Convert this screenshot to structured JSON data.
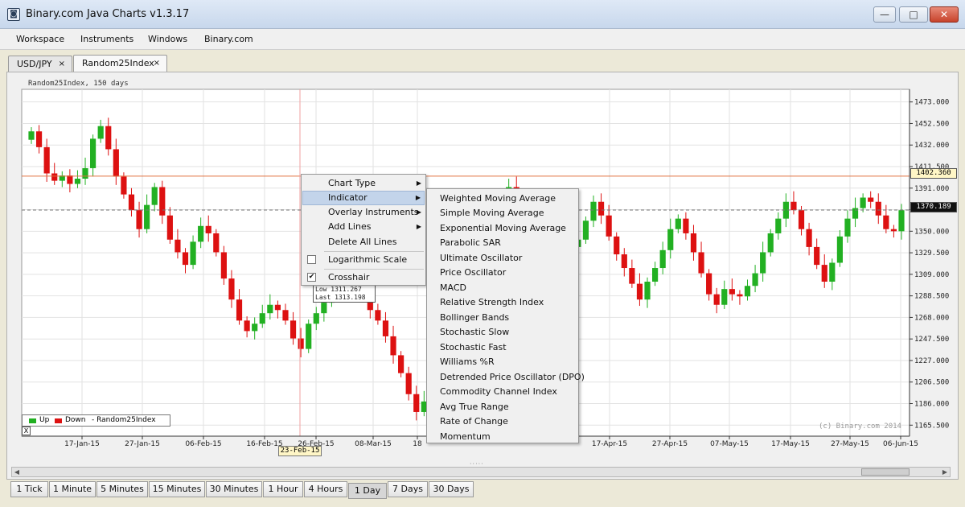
{
  "window": {
    "title": "Binary.com Java Charts v1.3.17",
    "minimize": "—",
    "maximize": "□",
    "close": "✕"
  },
  "menu": {
    "items": [
      "Workspace",
      "Instruments",
      "Windows",
      "Binary.com"
    ]
  },
  "tabs": [
    {
      "label": "USD/JPY",
      "close": "×"
    },
    {
      "label": "Random25Index",
      "close": "×"
    }
  ],
  "chart_header": "Random25Index, 150 days",
  "chart_data": {
    "type": "candlestick",
    "symbol": "Random25Index",
    "y_ticks": [
      "1473.000",
      "1452.500",
      "1432.000",
      "1411.500",
      "1391.000",
      "1370.500",
      "1350.000",
      "1329.500",
      "1309.000",
      "1288.500",
      "1268.000",
      "1247.500",
      "1227.000",
      "1206.500",
      "1186.000",
      "1165.500"
    ],
    "x_ticks": [
      "17-Jan-15",
      "27-Jan-15",
      "06-Feb-15",
      "16-Feb-15",
      "26-Feb-15",
      "08-Mar-15",
      "18",
      "17-Apr-15",
      "27-Apr-15",
      "07-May-15",
      "17-May-15",
      "27-May-15",
      "06-Jun-15"
    ],
    "ylim": [
      1155,
      1485
    ],
    "crosshair_price": "1402.360",
    "last_price": "1370.189",
    "crosshair_date": "23-Feb-15",
    "closes": [
      1445,
      1430,
      1405,
      1398,
      1403,
      1395,
      1400,
      1410,
      1438,
      1450,
      1428,
      1402,
      1385,
      1370,
      1352,
      1375,
      1392,
      1365,
      1342,
      1330,
      1318,
      1340,
      1355,
      1348,
      1330,
      1305,
      1285,
      1265,
      1255,
      1262,
      1272,
      1280,
      1275,
      1265,
      1248,
      1238,
      1262,
      1272,
      1282,
      1298,
      1315,
      1332,
      1312,
      1295,
      1275,
      1265,
      1250,
      1232,
      1215,
      1195,
      1178,
      1188,
      1205,
      1222,
      1242,
      1260,
      1280,
      1300,
      1325,
      1340,
      1355,
      1375,
      1392,
      1385,
      1380,
      1375,
      1368,
      1350,
      1332,
      1320,
      1335,
      1342,
      1360,
      1378,
      1365,
      1345,
      1328,
      1315,
      1300,
      1285,
      1302,
      1315,
      1332,
      1352,
      1362,
      1348,
      1330,
      1310,
      1290,
      1280,
      1295,
      1290,
      1288,
      1298,
      1310,
      1330,
      1348,
      1362,
      1378,
      1370,
      1352,
      1335,
      1318,
      1302,
      1320,
      1345,
      1362,
      1372,
      1382,
      1378,
      1365,
      1352,
      1350,
      1370
    ],
    "legend": {
      "up": "Up",
      "down": "Down",
      "series": "- Random25Index"
    },
    "colors": {
      "up": "#22b022",
      "down": "#dd1111",
      "crosshair": "#e07040",
      "grid": "#e2e2e2"
    }
  },
  "context_menu": {
    "items": [
      {
        "label": "Chart Type",
        "submenu": true
      },
      {
        "label": "Indicator",
        "submenu": true,
        "highlighted": true
      },
      {
        "label": "Overlay Instruments",
        "submenu": true
      },
      {
        "label": "Add Lines",
        "submenu": true
      },
      {
        "label": "Delete All Lines",
        "submenu": false
      }
    ],
    "checks": [
      {
        "label": "Logarithmic Scale",
        "checked": false
      },
      {
        "label": "Crosshair",
        "checked": true
      }
    ]
  },
  "indicator_submenu": [
    "Weighted Moving Average",
    "Simple Moving Average",
    "Exponential Moving Average",
    "Parabolic SAR",
    "Ultimate Oscillator",
    "Price Oscillator",
    "MACD",
    "Relative Strength Index",
    "Bollinger Bands",
    "Stochastic Slow",
    "Stochastic Fast",
    "Williams %R",
    "Detrended Price Oscillator (DPO)",
    "Commodity Channel Index",
    "Avg True Range",
    "Rate of Change",
    "Momentum"
  ],
  "tooltip": {
    "line1": "Low  1311.267",
    "line2": "Last 1313.198"
  },
  "copyright": "(c) Binary.com 2014",
  "legend_close": "X",
  "timeframes": [
    "1 Tick",
    "1 Minute",
    "5 Minutes",
    "15 Minutes",
    "30 Minutes",
    "1 Hour",
    "4 Hours",
    "1 Day",
    "7 Days",
    "30 Days"
  ],
  "active_timeframe": "1 Day"
}
